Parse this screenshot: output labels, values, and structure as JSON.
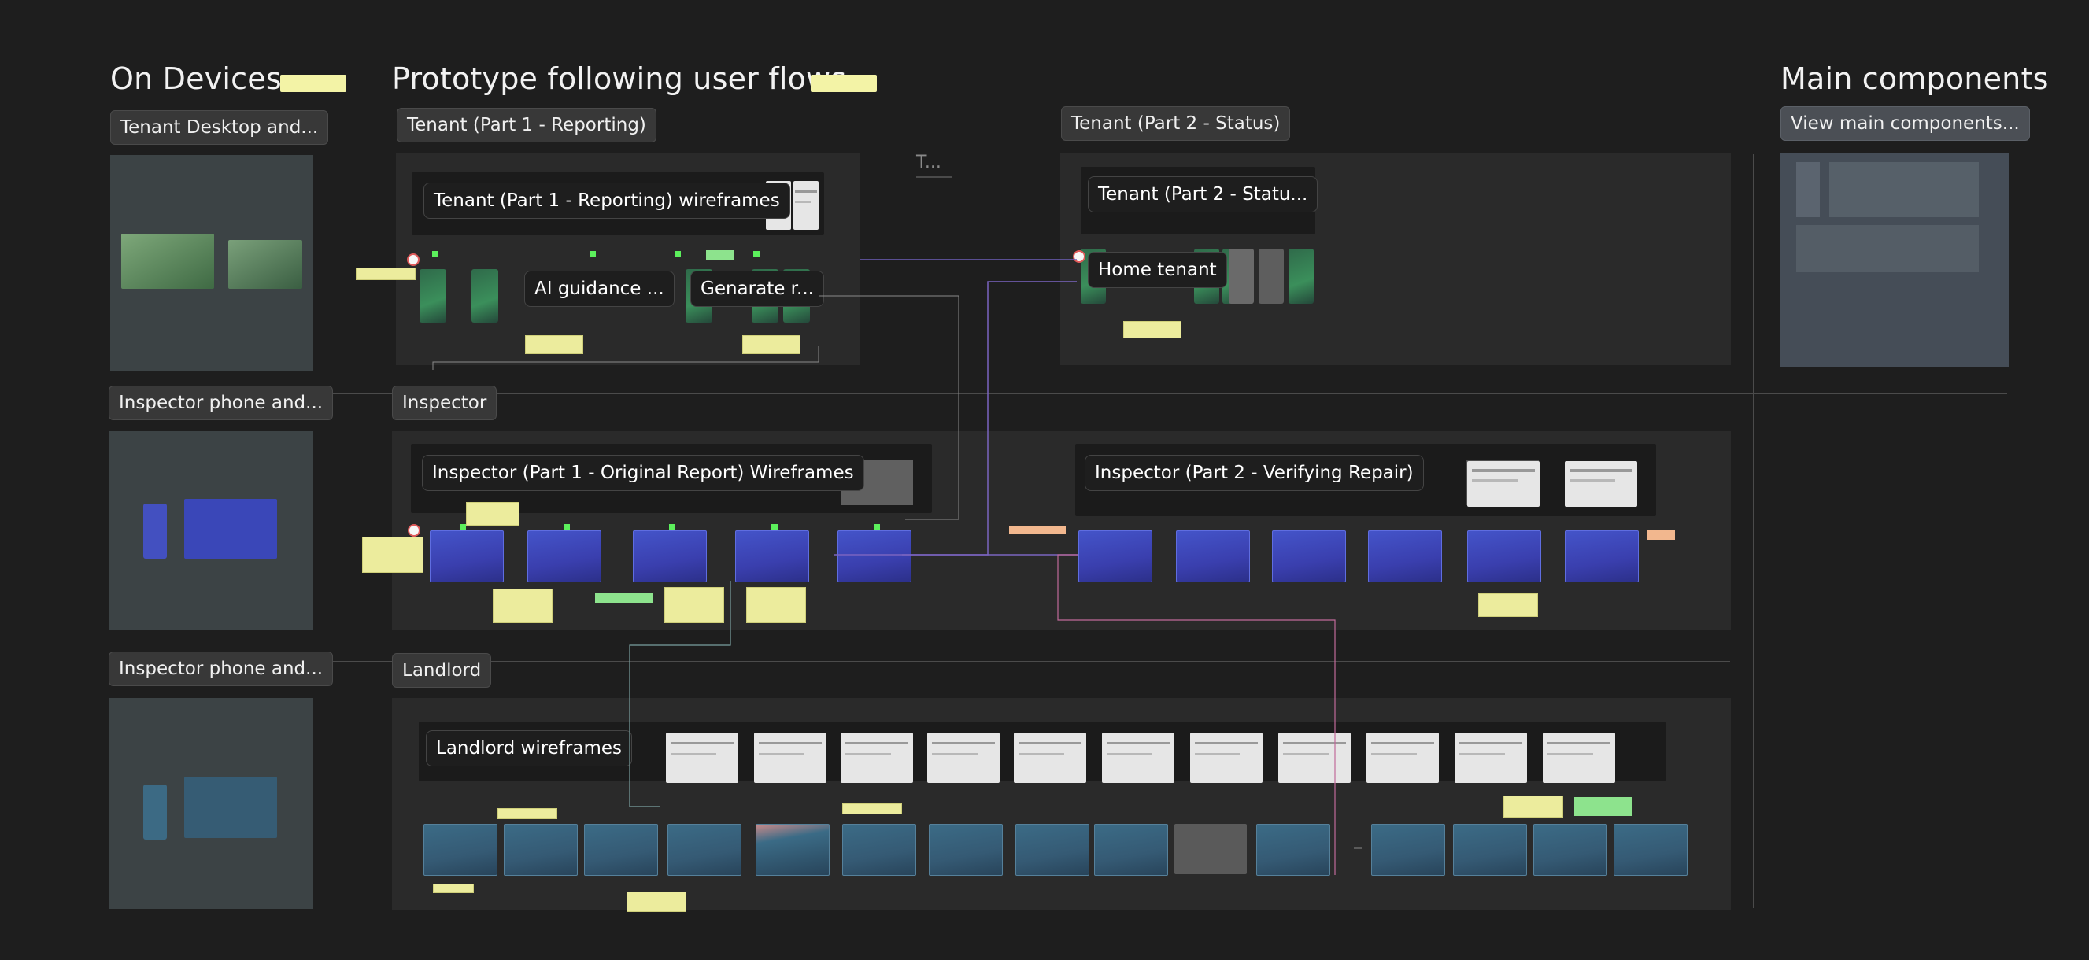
{
  "sections": {
    "on_devices": "On Devices",
    "prototype": "Prototype following user flows",
    "main_components": "Main components"
  },
  "chips": {
    "tenant_desktop": "Tenant Desktop and...",
    "inspector_phone_1": "Inspector phone and...",
    "inspector_phone_2": "Inspector phone and...",
    "tenant_part1": "Tenant (Part 1 - Reporting)",
    "tenant_part2": "Tenant (Part 2 - Status)",
    "inspector": "Inspector",
    "landlord": "Landlord",
    "view_main_components": "View main components..."
  },
  "labels": {
    "tenant_part1_wireframes": "Tenant (Part 1 - Reporting) wireframes",
    "ai_guidance": "AI guidance ...",
    "genarate": "Genarate r...",
    "tenant_part2_status": "Tenant (Part 2 - Statu...",
    "home_tenant": "Home tenant",
    "inspector_part1": "Inspector (Part 1 - Original Report) Wireframes",
    "inspector_part2": "Inspector (Part 2 - Verifying Repair)",
    "landlord_wireframes": "Landlord wireframes"
  },
  "misc": {
    "faint_text": "T..."
  },
  "colors": {
    "canvas": "#1e1e1e",
    "panel": "#2a2a2a",
    "device_panel": "#3c4345",
    "swatch": "#f3f3a6",
    "sticky_note": "#ecec9d",
    "flow_start": "#e05a5a",
    "hotspot": "#5cf05c"
  }
}
